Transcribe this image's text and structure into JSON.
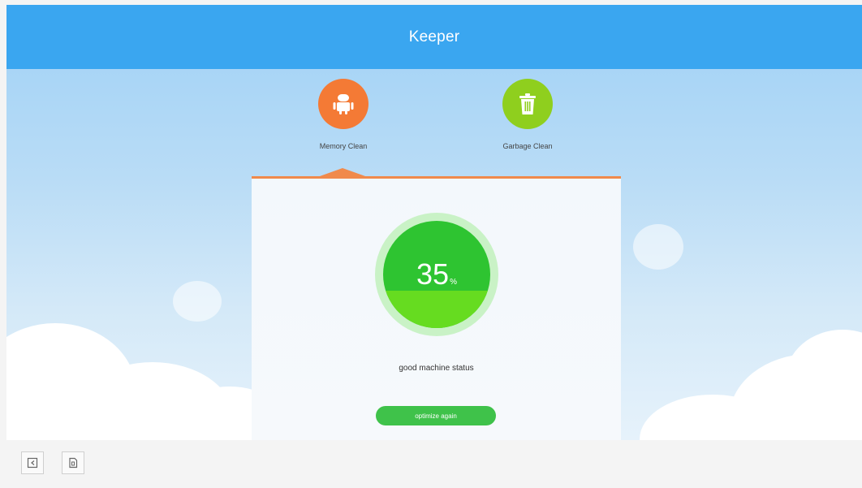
{
  "app": {
    "title": "Keeper"
  },
  "tabs": [
    {
      "label": "Memory Clean",
      "icon": "android-robot-icon",
      "color": "#f47a35",
      "selected": true
    },
    {
      "label": "Garbage Clean",
      "icon": "trash-can-icon",
      "color": "#8fcf1e",
      "selected": false
    }
  ],
  "gauge": {
    "value": "35",
    "unit": "%",
    "fill_fraction": 0.35
  },
  "status_text": "good machine status",
  "optimize_button": {
    "label": "optimize again"
  },
  "bottom_bar": {
    "buttons": [
      {
        "icon": "exit-icon"
      },
      {
        "icon": "document-icon"
      }
    ]
  },
  "colors": {
    "header": "#3aa6f0",
    "accent_orange": "#f08a4b",
    "gauge_green": "#2ec431",
    "gauge_fill": "#66dc20",
    "button_green": "#3fc24a"
  }
}
